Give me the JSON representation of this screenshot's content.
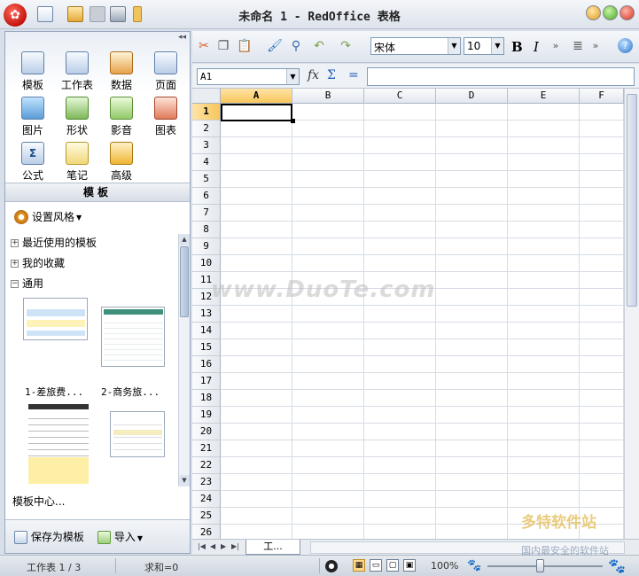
{
  "window": {
    "title": "未命名 1 - RedOffice 表格"
  },
  "tools": [
    {
      "label": "模板",
      "icon": "template-icon"
    },
    {
      "label": "工作表",
      "icon": "worksheet-icon"
    },
    {
      "label": "数据",
      "icon": "data-icon"
    },
    {
      "label": "页面",
      "icon": "page-icon"
    },
    {
      "label": "图片",
      "icon": "picture-icon"
    },
    {
      "label": "形状",
      "icon": "shape-icon"
    },
    {
      "label": "影音",
      "icon": "media-icon"
    },
    {
      "label": "图表",
      "icon": "chart-icon"
    },
    {
      "label": "公式",
      "icon": "formula-icon"
    },
    {
      "label": "笔记",
      "icon": "note-icon"
    },
    {
      "label": "高级",
      "icon": "advanced-icon"
    }
  ],
  "panel": {
    "section_title": "模板",
    "style_button": "设置风格",
    "tree": {
      "recent": "最近使用的模板",
      "favorites": "我的收藏",
      "general": "通用"
    },
    "thumbnails": [
      "1-差旅费...",
      "2-商务旅..."
    ],
    "template_center": "模板中心...",
    "save_as_template": "保存为模板",
    "import": "导入"
  },
  "toolbar": {
    "font_name": "宋体",
    "font_size": "10",
    "bold": "B",
    "italic": "I"
  },
  "formula_bar": {
    "name_box": "A1",
    "fx": "fx",
    "sum": "Σ",
    "equals": "="
  },
  "grid": {
    "columns": [
      "A",
      "B",
      "C",
      "D",
      "E",
      "F"
    ],
    "rows": [
      "1",
      "2",
      "3",
      "4",
      "5",
      "6",
      "7",
      "8",
      "9",
      "10",
      "11",
      "12",
      "13",
      "14",
      "15",
      "16",
      "17",
      "18",
      "19",
      "20",
      "21",
      "22",
      "23",
      "24",
      "25",
      "26"
    ],
    "active_cell": "A1"
  },
  "sheet_tab": "工...",
  "status": {
    "sheet": "工作表 1 / 3",
    "sum": "求和=0",
    "zoom": "100%"
  },
  "watermark": "www.DuoTe.com",
  "watermark_logo": "多特软件站",
  "watermark_sub": "国内最安全的软件站"
}
